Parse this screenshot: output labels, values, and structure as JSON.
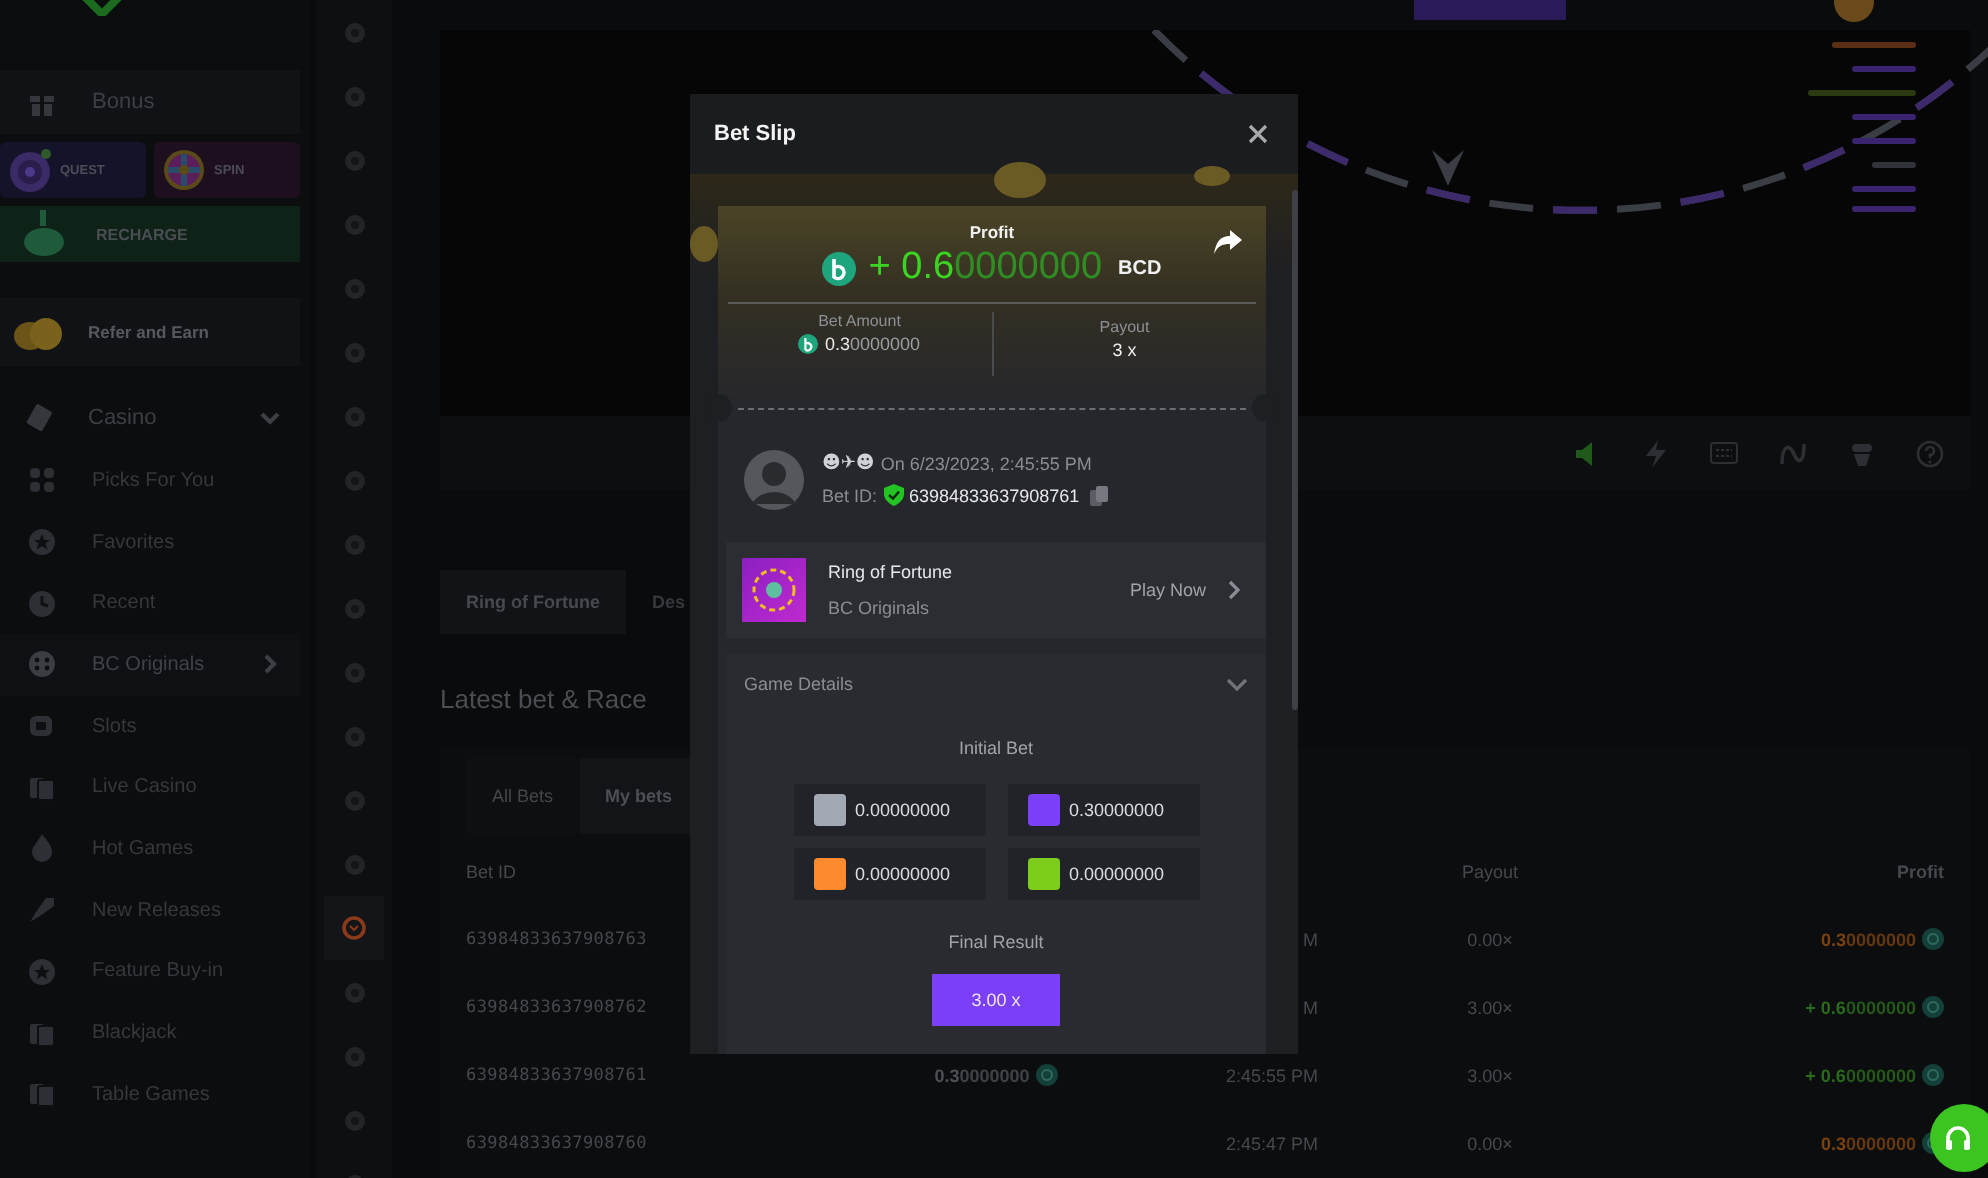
{
  "sidebar": {
    "bonus": "Bonus",
    "promos": [
      {
        "label": "QUEST"
      },
      {
        "label": "SPIN"
      }
    ],
    "recharge": "RECHARGE",
    "refer": "Refer and Earn",
    "casino": {
      "label": "Casino",
      "expanded": true,
      "items": [
        {
          "label": "Picks For You",
          "selected": false,
          "submenu": false
        },
        {
          "label": "Favorites",
          "selected": false,
          "submenu": false
        },
        {
          "label": "Recent",
          "selected": false,
          "submenu": false
        },
        {
          "label": "BC Originals",
          "selected": true,
          "submenu": true
        },
        {
          "label": "Slots",
          "selected": false,
          "submenu": false
        },
        {
          "label": "Live Casino",
          "selected": false,
          "submenu": false
        },
        {
          "label": "Hot Games",
          "selected": false,
          "submenu": false
        },
        {
          "label": "New Releases",
          "selected": false,
          "submenu": false
        },
        {
          "label": "Feature Buy-in",
          "selected": false,
          "submenu": false
        },
        {
          "label": "Blackjack",
          "selected": false,
          "submenu": false
        },
        {
          "label": "Table Games",
          "selected": false,
          "submenu": false
        }
      ]
    }
  },
  "rail_icons": [
    {
      "selected": false
    },
    {
      "selected": false
    },
    {
      "selected": false
    },
    {
      "selected": false
    },
    {
      "selected": false
    },
    {
      "selected": false
    },
    {
      "selected": false
    },
    {
      "selected": false
    },
    {
      "selected": false
    },
    {
      "selected": false
    },
    {
      "selected": false
    },
    {
      "selected": false
    },
    {
      "selected": false
    },
    {
      "selected": false
    },
    {
      "selected": true
    },
    {
      "selected": false
    },
    {
      "selected": false
    },
    {
      "selected": false
    },
    {
      "selected": false
    }
  ],
  "game_tabs": [
    {
      "label": "Ring of Fortune",
      "selected": true
    },
    {
      "label": "Des",
      "selected": false
    }
  ],
  "section_title": "Latest bet & Race",
  "bet_tabs": [
    {
      "label": "All Bets",
      "selected": false
    },
    {
      "label": "My bets",
      "selected": true
    }
  ],
  "table": {
    "columns": [
      {
        "kind": "id",
        "label": "Bet ID"
      },
      {
        "kind": "payout",
        "label": "Payout"
      },
      {
        "kind": "profit",
        "label": "Profit"
      }
    ],
    "rows": [
      {
        "bet_id": "63984833637908763",
        "time": "M",
        "payout": "0.00×",
        "profit": "0.30000000",
        "kind": "loss"
      },
      {
        "bet_id": "63984833637908762",
        "time": "M",
        "payout": "3.00×",
        "profit": "+ 0.60000000",
        "kind": "win"
      },
      {
        "bet_id": "63984833637908761",
        "amount": "0.30000000",
        "time": "2:45:55 PM",
        "payout": "3.00×",
        "profit": "+ 0.60000000",
        "kind": "win"
      },
      {
        "bet_id": "63984833637908760",
        "time": "2:45:47 PM",
        "payout": "0.00×",
        "profit": "0.30000000",
        "kind": "loss"
      }
    ]
  },
  "bet_slip": {
    "title": "Bet Slip",
    "profit_label": "Profit",
    "profit": "+ 0.60000000",
    "currency": "BCD",
    "bet_amount_label": "Bet Amount",
    "bet_amount": "0.30000000",
    "payout_label": "Payout",
    "payout": "3 x",
    "player": "☻✈☻",
    "date": "On 6/23/2023, 2:45:55 PM",
    "bet_id_label": "Bet ID:",
    "bet_id": "63984833637908761",
    "game": {
      "name": "Ring of Fortune",
      "provider": "BC Originals",
      "action": "Play Now"
    },
    "details": {
      "title": "Game Details",
      "expanded": true,
      "initial_bet_label": "Initial Bet",
      "bets": [
        {
          "color": "#a2a8b4",
          "amount": "0.00000000"
        },
        {
          "color": "#7b3ff7",
          "amount": "0.30000000"
        },
        {
          "color": "#fd8a2f",
          "amount": "0.00000000"
        },
        {
          "color": "#7ccd1c",
          "amount": "0.00000000"
        }
      ],
      "final_result_label": "Final Result",
      "final_result": "3.00 x"
    }
  }
}
